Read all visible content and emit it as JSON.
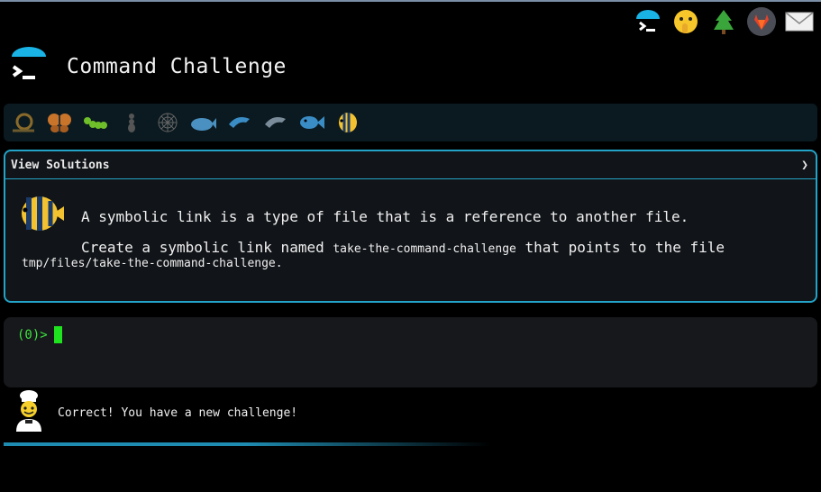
{
  "header": {
    "title": "Command Challenge"
  },
  "top_nav": [
    {
      "icon": "terminal-icon",
      "label": "Terminal"
    },
    {
      "icon": "face-shushing-icon",
      "label": "Hints"
    },
    {
      "icon": "tree-icon",
      "label": "Tree"
    },
    {
      "icon": "gitlab-icon",
      "label": "GitLab"
    },
    {
      "icon": "mail-icon",
      "label": "Mail"
    }
  ],
  "progress": [
    "snail-icon",
    "butterfly-icon",
    "caterpillar-icon",
    "ant-icon",
    "spider-web-icon",
    "whale-icon",
    "dolphin-icon",
    "dolphin-icon",
    "fish-icon",
    "tropical-fish-icon"
  ],
  "challenge": {
    "view_solutions_label": "View Solutions",
    "chevron": "❯",
    "line1": "A symbolic link is a type of file that is a reference to another file.",
    "line2_prefix": "Create a symbolic link named ",
    "line2_code": "take-the-command-challenge",
    "line2_suffix": " that points to the file",
    "line3": "tmp/files/take-the-command-challenge."
  },
  "terminal": {
    "prompt": "(0)>"
  },
  "status": {
    "message": "Correct! You have a new challenge!"
  },
  "colors": {
    "accent": "#23a3c7",
    "prompt": "#3ee23e",
    "background": "#000000"
  }
}
